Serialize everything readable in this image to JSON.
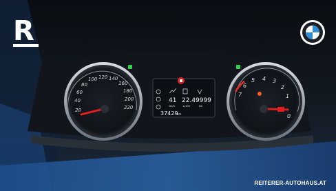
{
  "branding": {
    "logo_letter": "R",
    "dealer_site": "REITERER-AUTOHAUS.AT",
    "bmw_logo_letters": "BMW"
  },
  "speedometer": {
    "ticks": [
      "20",
      "40",
      "60",
      "80",
      "100",
      "120",
      "140",
      "160",
      "180",
      "200",
      "220"
    ]
  },
  "tachometer": {
    "ticks": [
      "7",
      "6",
      "5",
      "4",
      "3",
      "2",
      "1",
      "0"
    ]
  },
  "center_display": {
    "values": [
      "41",
      "22.4",
      "9999"
    ],
    "units": [
      "km/h",
      "L/100",
      "km"
    ],
    "odometer": "37429",
    "odometer_unit": "km"
  },
  "colors": {
    "needle": "#e01e1e",
    "warning_light": "#ff5a1f",
    "indicator_green": "#2fd24a",
    "panel_blue": "#1e4d8c"
  }
}
